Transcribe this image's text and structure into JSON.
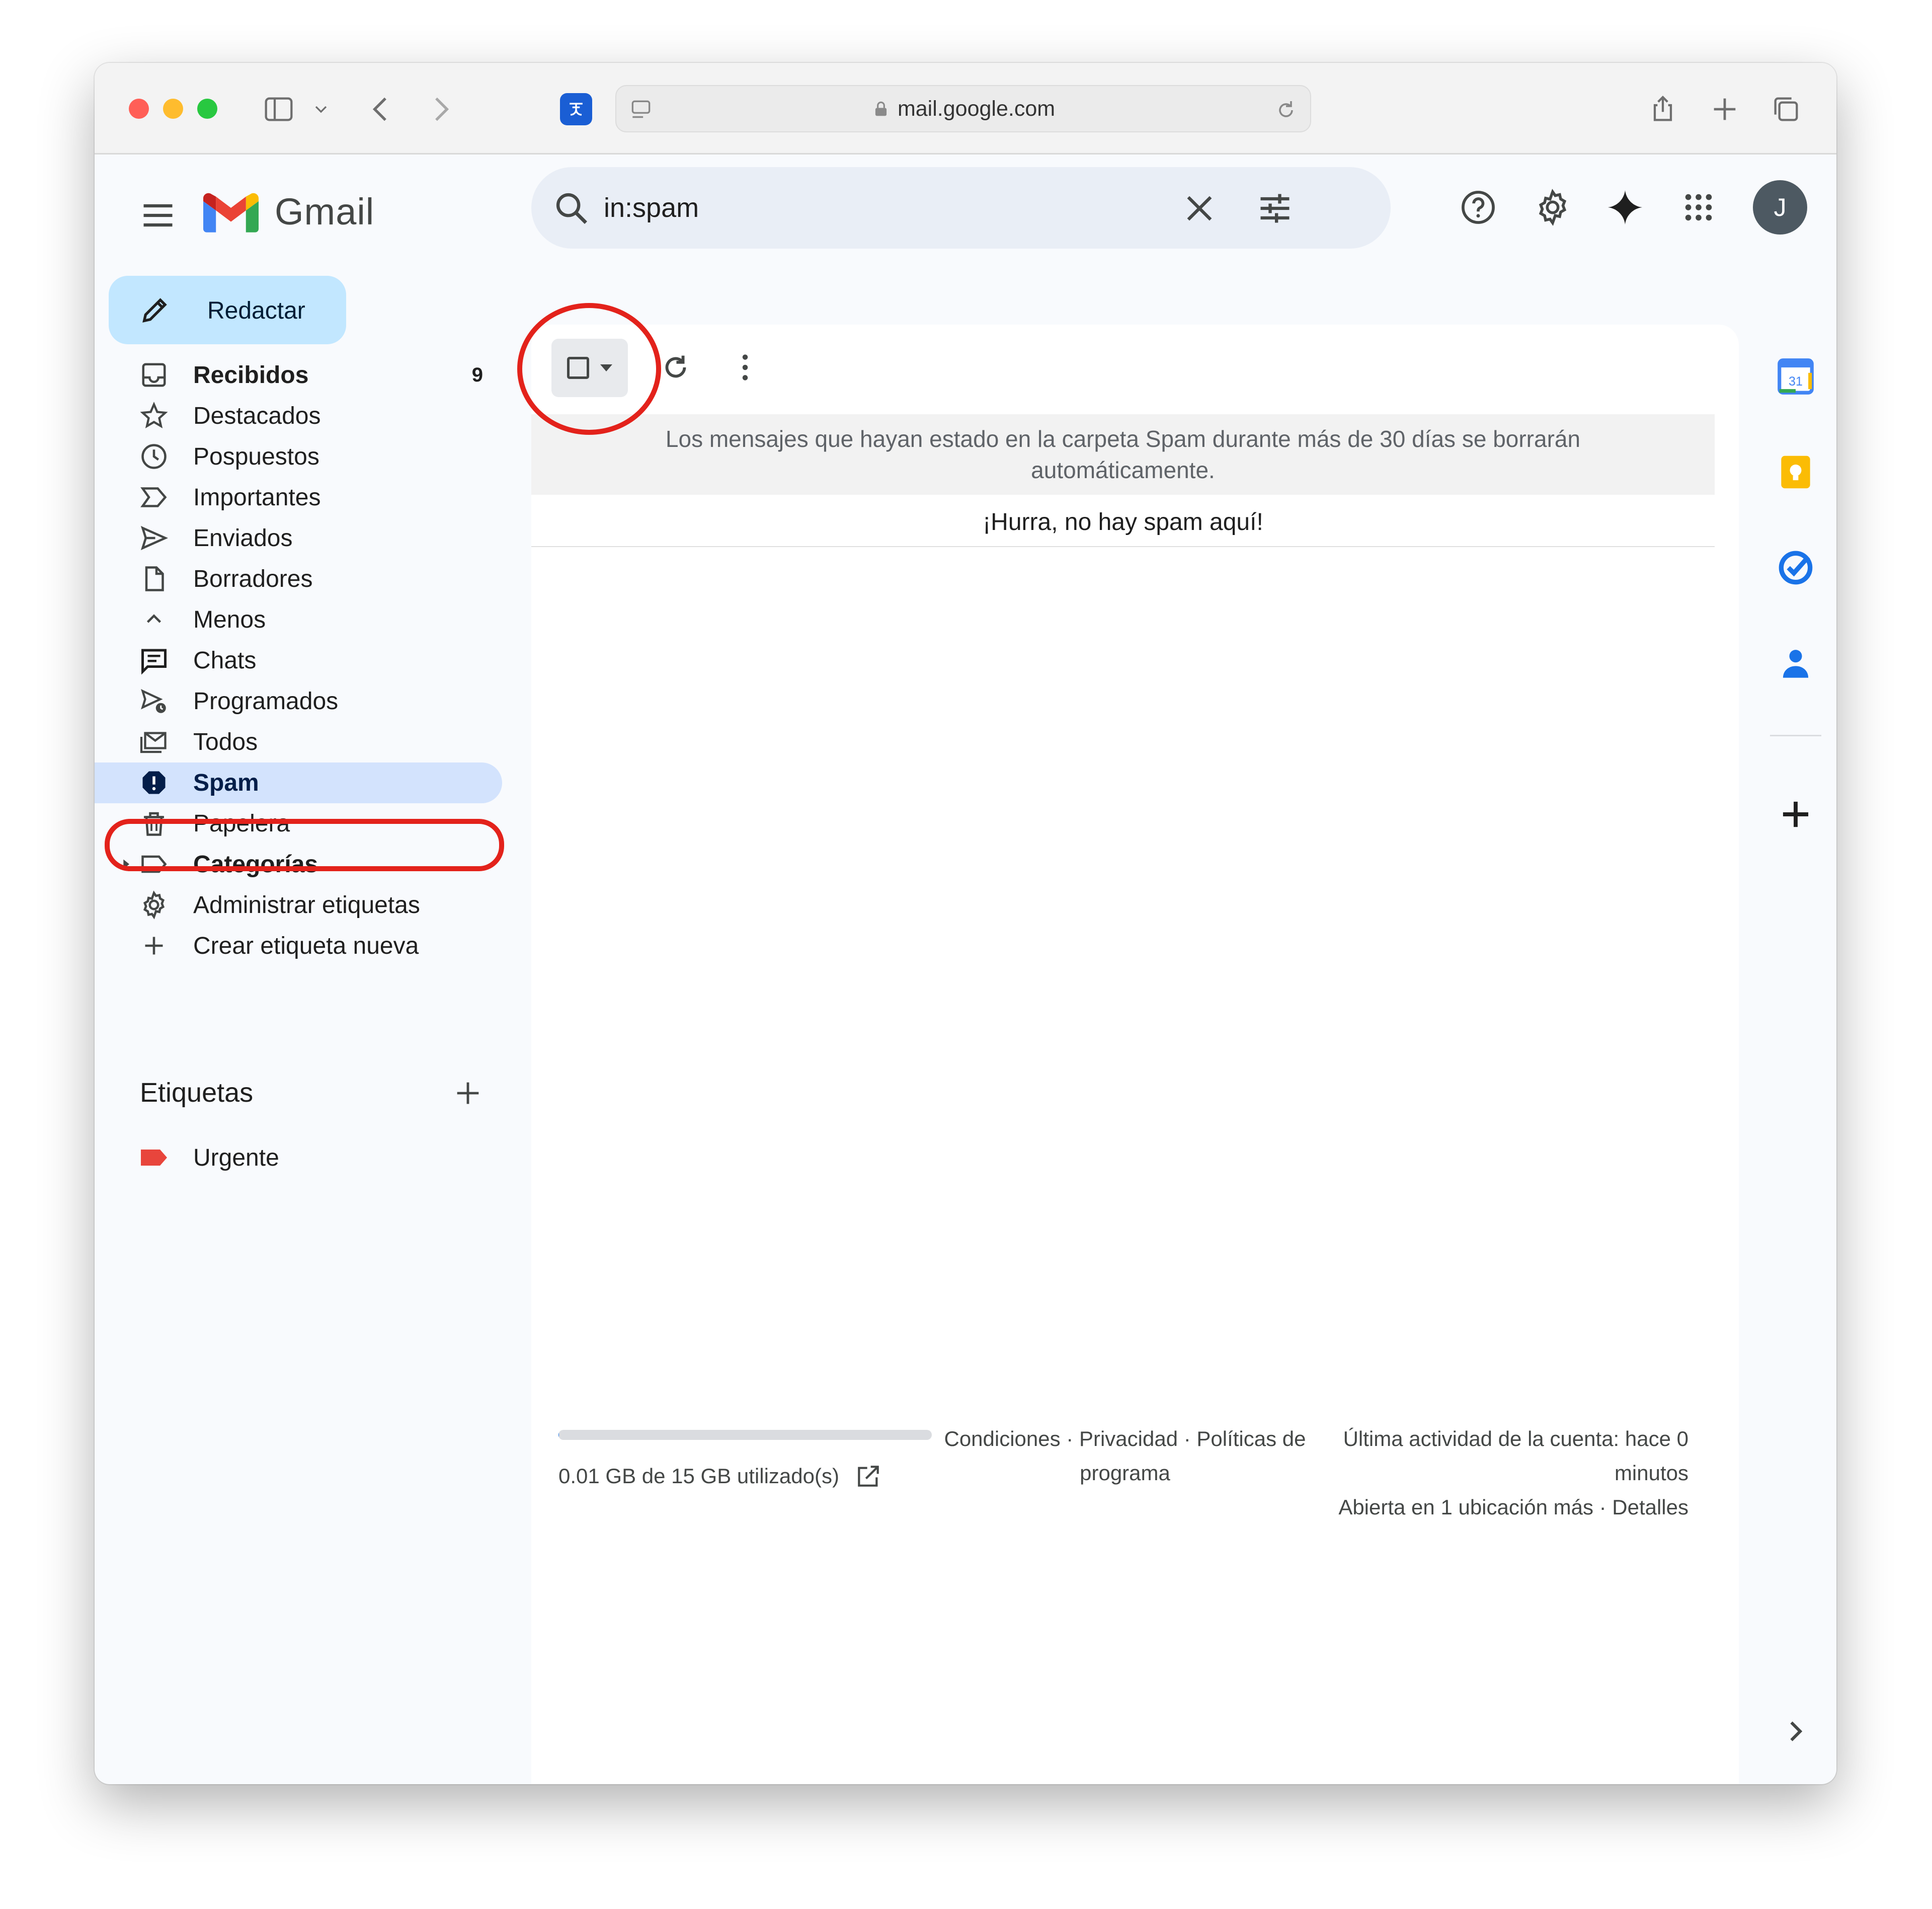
{
  "browser": {
    "url": "mail.google.com"
  },
  "app": {
    "name": "Gmail",
    "account_initial": "J"
  },
  "search": {
    "query": "in:spam"
  },
  "compose": {
    "label": "Redactar"
  },
  "nav": {
    "items": [
      {
        "label": "Recibidos",
        "count": "9",
        "icon": "inbox-icon",
        "bold": true
      },
      {
        "label": "Destacados",
        "icon": "star-icon"
      },
      {
        "label": "Pospuestos",
        "icon": "clock-icon"
      },
      {
        "label": "Importantes",
        "icon": "important-icon"
      },
      {
        "label": "Enviados",
        "icon": "send-icon"
      },
      {
        "label": "Borradores",
        "icon": "draft-icon"
      },
      {
        "label": "Menos",
        "icon": "chevron-up-icon"
      },
      {
        "label": "Chats",
        "icon": "chat-icon"
      },
      {
        "label": "Programados",
        "icon": "scheduled-send-icon"
      },
      {
        "label": "Todos",
        "icon": "all-mail-icon"
      },
      {
        "label": "Spam",
        "icon": "spam-icon",
        "active": true
      },
      {
        "label": "Papelera",
        "icon": "trash-icon"
      },
      {
        "label": "Categorías",
        "icon": "label-icon",
        "bold": true
      },
      {
        "label": "Administrar etiquetas",
        "icon": "gear-icon"
      },
      {
        "label": "Crear etiqueta nueva",
        "icon": "plus-icon"
      }
    ]
  },
  "labels": {
    "title": "Etiquetas",
    "items": [
      {
        "label": "Urgente",
        "color": "#e8453c"
      }
    ]
  },
  "main": {
    "notice": "Los mensajes que hayan estado en la carpeta Spam durante más de 30 días se borrarán automáticamente.",
    "empty_message": "¡Hurra, no hay spam aquí!"
  },
  "footer": {
    "storage_text": "0.01 GB de 15 GB utilizado(s)",
    "storage_fraction": 0.0007,
    "links_line1": "Condiciones · Privacidad · Políticas de",
    "links_line2": "programa",
    "activity_line1": "Última actividad de la cuenta: hace 0",
    "activity_line2": "minutos",
    "activity_line3": "Abierta en 1 ubicación más · Detalles"
  },
  "colors": {
    "accent_blue": "#1a73e8",
    "active_nav": "#d3e3fd",
    "compose_bg": "#c2e7ff",
    "highlight_red": "#e3221b"
  }
}
